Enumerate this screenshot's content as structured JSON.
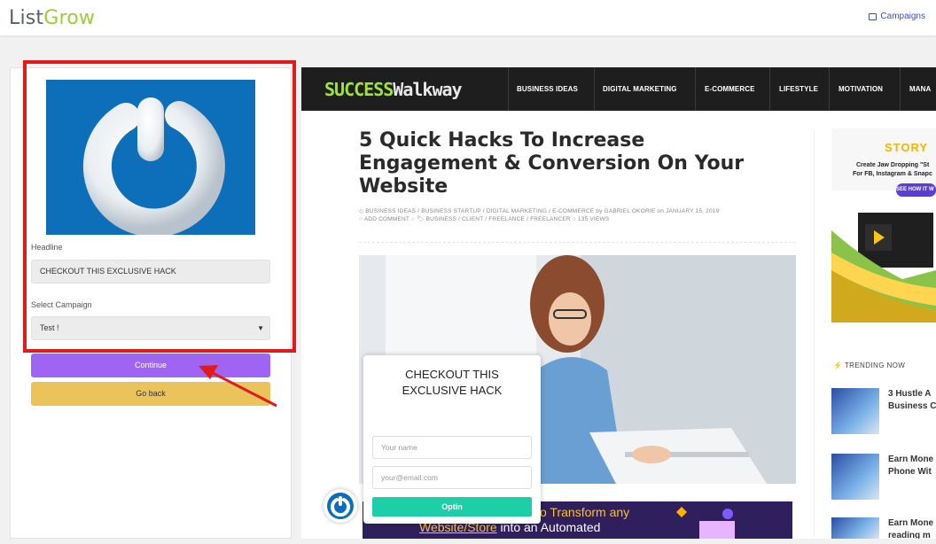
{
  "app": {
    "logo_main": "List",
    "logo_accent": "Grow",
    "nav_campaigns": "Campaigns"
  },
  "form": {
    "headline_label": "Headline",
    "headline_value": "CHECKOUT THIS EXCLUSIVE HACK",
    "campaign_label": "Select Campaign",
    "campaign_value": "Test !",
    "continue_label": "Continue",
    "back_label": "Go back"
  },
  "site": {
    "logo_a": "SUCCESS",
    "logo_b": "Walkway",
    "nav": [
      "BUSINESS IDEAS",
      "DIGITAL MARKETING",
      "E-COMMERCE",
      "LIFESTYLE",
      "MOTIVATION",
      "MANA"
    ],
    "article_title": "5 Quick Hacks To Increase Engagement & Conversion On Your Website",
    "meta_line1": "◇ BUSINESS IDEAS / BUSINESS STARTUP / DIGITAL MARKETING / E-COMMERCE   by  GABRIEL OKORIE   on  JANUARY 15, 2019",
    "meta_line2": "○ ADD COMMENT  ○ 🏷  BUSINESS / CLIENT / FREELANCE / FREELANCER  ○ 135 VIEWS",
    "banner_line1": "o Transform any",
    "banner_line2a": "Website/Store",
    "banner_line2b": " into an Automated",
    "ad_brand": "STORY",
    "ad_line1": "Create Jaw Dropping \"St",
    "ad_line2": "For FB, Instagram & Snapc",
    "ad_cta": "SEE HOW IT W",
    "trending_label": "TRENDING NOW",
    "trending": [
      {
        "l1": "3 Hustle A",
        "l2": "Business C"
      },
      {
        "l1": "Earn Mone",
        "l2": "Phone Wit"
      },
      {
        "l1": "Earn Mone",
        "l2": "reading m"
      }
    ]
  },
  "popup": {
    "headline": "CHECKOUT THIS EXCLUSIVE HACK",
    "name_placeholder": "Your name",
    "email_placeholder": "your@email.com",
    "button": "Optin"
  },
  "colors": {
    "accent_purple": "#a064f2",
    "accent_yellow": "#eac45a",
    "optin_green": "#1ccfa7",
    "highlight_red": "#e01b1b"
  }
}
